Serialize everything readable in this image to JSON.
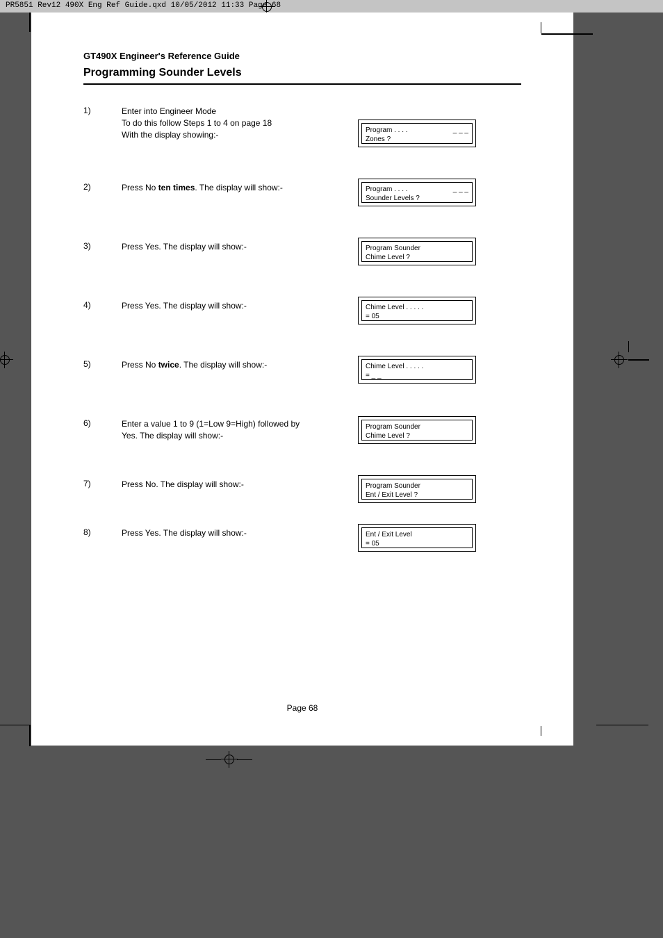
{
  "header_bar": "PR5851 Rev12 490X Eng Ref Guide.qxd  10/05/2012  11:33  Page 68",
  "guide_title": "GT490X Engineer's Reference Guide",
  "section_title": "Programming Sounder Levels",
  "steps": [
    {
      "num": "1)",
      "text_lines": [
        "Enter into Engineer Mode",
        "To do this follow Steps 1 to 4 on page 18",
        "With the display showing:-"
      ],
      "display": {
        "line1_left": "Program . . . .",
        "line1_right": "_ _ _",
        "line2": "Zones ?"
      }
    },
    {
      "num": "2)",
      "text_prefix": "Press No ",
      "text_bold": "ten times",
      "text_suffix": ". The display will show:-",
      "display": {
        "line1_left": "Program . . . .",
        "line1_right": "_ _ _",
        "line2": "Sounder Levels ?"
      }
    },
    {
      "num": "3)",
      "text": "Press Yes. The display will show:-",
      "display": {
        "line1_left": "Program Sounder",
        "line1_right": "",
        "line2": "Chime Level ?"
      }
    },
    {
      "num": "4)",
      "text": "Press Yes. The display will show:-",
      "display": {
        "line1_left": "Chime Level . . . . .",
        "line1_right": "",
        "line2": "= 05"
      }
    },
    {
      "num": "5)",
      "text_prefix": "Press No ",
      "text_bold": "twice",
      "text_suffix": ". The display will show:-",
      "display": {
        "line1_left": "Chime Level . . . . .",
        "line1_right": "",
        "line2": "= _ _"
      }
    },
    {
      "num": "6)",
      "text_lines": [
        "Enter a value 1 to 9 (1=Low 9=High) followed by",
        "Yes. The display will show:-"
      ],
      "display": {
        "line1_left": "Program Sounder",
        "line1_right": "",
        "line2": "Chime Level ?"
      }
    },
    {
      "num": "7)",
      "text": "Press No. The display will show:-",
      "display": {
        "line1_left": "Program Sounder",
        "line1_right": "",
        "line2": "Ent / Exit Level ?"
      }
    },
    {
      "num": "8)",
      "text": "Press Yes. The display will show:-",
      "display": {
        "line1_left": "Ent / Exit Level",
        "line1_right": "",
        "line2": "= 05"
      }
    }
  ],
  "page_footer": "Page  68"
}
